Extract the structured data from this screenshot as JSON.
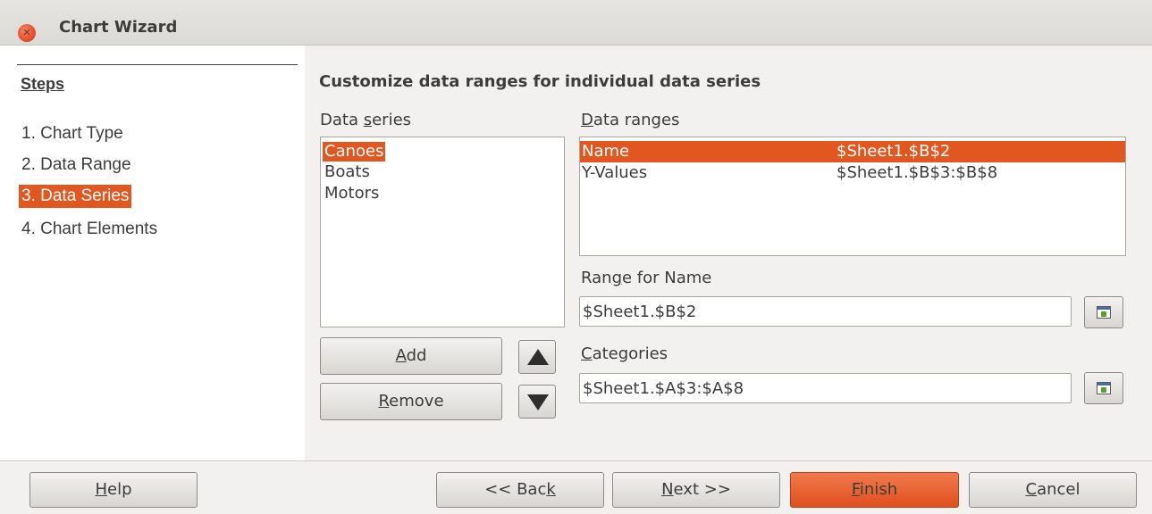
{
  "window": {
    "title": "Chart Wizard"
  },
  "steps": {
    "heading": "Steps",
    "items": [
      {
        "label": "1. Chart Type",
        "active": false
      },
      {
        "label": "2. Data Range",
        "active": false
      },
      {
        "label": "3. Data Series",
        "active": true
      },
      {
        "label": "4. Chart Elements",
        "active": false
      }
    ]
  },
  "main": {
    "title": "Customize data ranges for individual data series",
    "data_series": {
      "label_pre": "Data ",
      "label_ul": "s",
      "label_post": "eries",
      "items": [
        "Canoes",
        "Boats",
        "Motors"
      ],
      "selected_index": 0
    },
    "data_ranges": {
      "label_pre": "",
      "label_ul": "D",
      "label_post": "ata ranges",
      "rows": [
        {
          "name": "Name",
          "range": "$Sheet1.$B$2",
          "selected": true
        },
        {
          "name": "Y-Values",
          "range": "$Sheet1.$B$3:$B$8",
          "selected": false
        }
      ]
    },
    "range_for_name": {
      "label_pre": "Ran",
      "label_ul": "g",
      "label_post": "e for Name",
      "value": "$Sheet1.$B$2"
    },
    "categories": {
      "label_pre": "",
      "label_ul": "C",
      "label_post": "ategories",
      "value": "$Sheet1.$A$3:$A$8"
    },
    "add_button": {
      "pre": "",
      "ul": "A",
      "post": "dd"
    },
    "remove_button": {
      "pre": "",
      "ul": "R",
      "post": "emove"
    },
    "move_up_icon": "triangle-up-icon",
    "move_down_icon": "triangle-down-icon",
    "shrink_icon": "shrink-range-icon"
  },
  "footer": {
    "help": {
      "pre": "",
      "ul": "H",
      "post": "elp"
    },
    "back": {
      "pre": "<< Bac",
      "ul": "k",
      "post": ""
    },
    "next": {
      "pre": "",
      "ul": "N",
      "post": "ext >>"
    },
    "finish": {
      "pre": "",
      "ul": "F",
      "post": "inish"
    },
    "cancel": {
      "pre": "",
      "ul": "C",
      "post": "ancel"
    }
  },
  "colors": {
    "accent": "#e2561f",
    "titlebar": "#dcdad6",
    "window_bg": "#f2f1f0"
  }
}
